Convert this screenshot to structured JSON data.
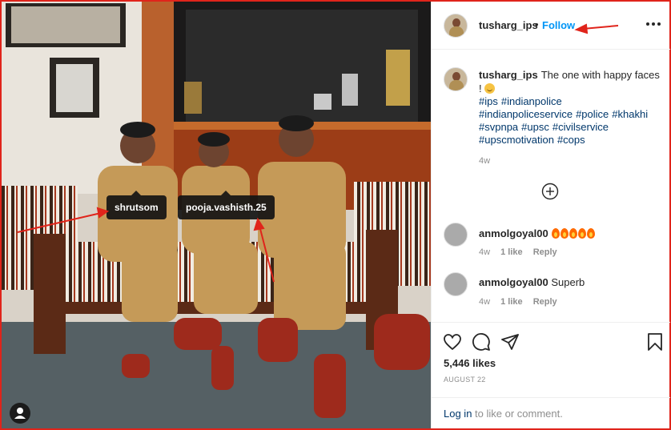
{
  "post": {
    "username": "tusharg_ips",
    "dot": "•",
    "follow_label": "Follow",
    "caption_text": "The one with happy faces !",
    "hashtags": [
      "#ips",
      "#indianpolice",
      "#indianpoliceservice",
      "#police",
      "#khakhi",
      "#svpnpa",
      "#upsc",
      "#civilservice",
      "#upscmotivation",
      "#cops"
    ],
    "caption_time": "4w",
    "likes": "5,446 likes",
    "date": "AUGUST 22"
  },
  "photo": {
    "tags": [
      "shrutsom",
      "pooja.vashisth.25"
    ]
  },
  "comments": [
    {
      "username": "anmolgoyal00",
      "text": "",
      "fire_count": 5,
      "time": "4w",
      "likes": "1 like",
      "reply": "Reply"
    },
    {
      "username": "anmolgoyal00",
      "text": "Superb",
      "fire_count": 0,
      "time": "4w",
      "likes": "1 like",
      "reply": "Reply"
    }
  ],
  "login": {
    "link": "Log in",
    "rest": "to like or comment."
  },
  "icons": [
    "heart-icon",
    "comment-icon",
    "share-icon",
    "bookmark-icon",
    "more-options-icon",
    "add-circle-icon",
    "user-tag-icon"
  ],
  "colors": {
    "follow_blue": "#0095f6",
    "hashtag_blue": "#00376b",
    "annotation_red": "#e0241b",
    "text": "#262626",
    "muted": "#8e8e8e"
  }
}
